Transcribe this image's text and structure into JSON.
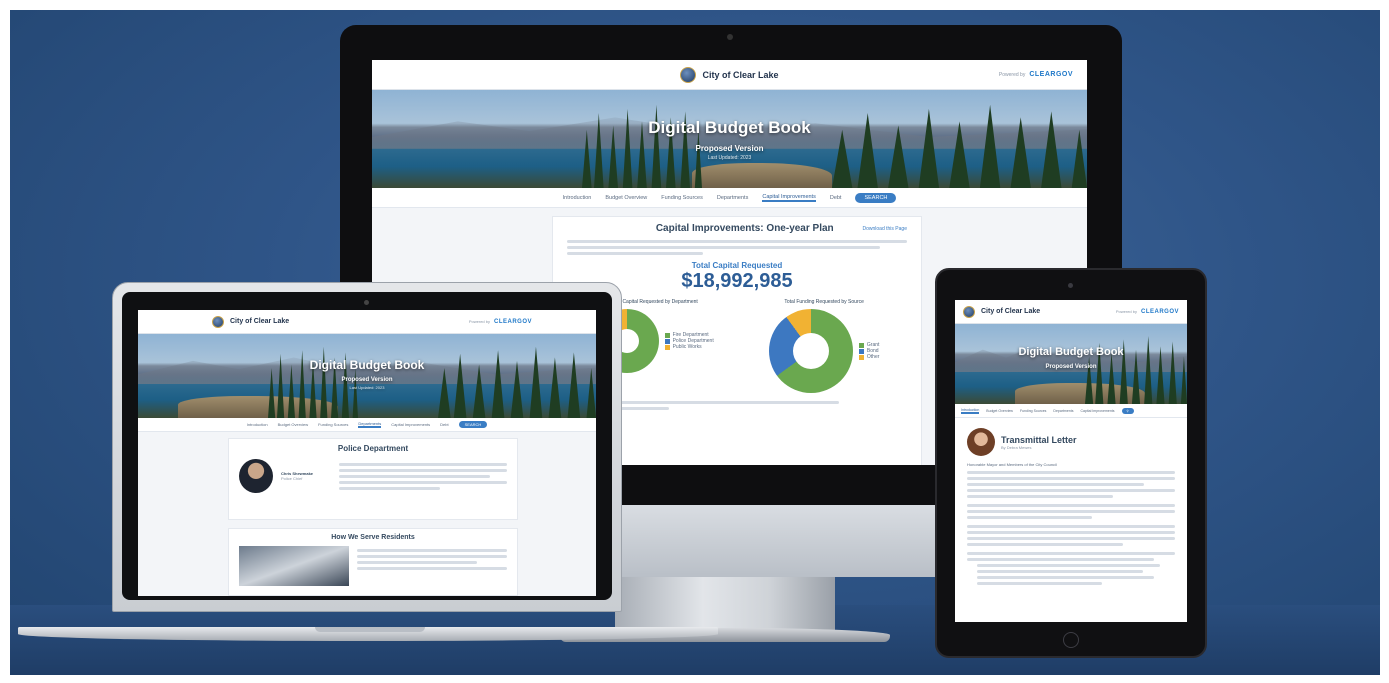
{
  "site": {
    "city_name": "City of Clear Lake",
    "powered_by": "Powered by",
    "vendor": "CLEARGOV",
    "hero_title": "Digital Budget Book",
    "hero_version": "Proposed Version",
    "hero_fy": "Last Updated: 2023",
    "search_label": "SEARCH"
  },
  "desktop": {
    "nav": [
      "Introduction",
      "Budget Overview",
      "Funding Sources",
      "Departments",
      "Capital Improvements",
      "Debt"
    ],
    "active_nav": "Capital Improvements",
    "page_title": "Capital Improvements: One-year Plan",
    "download_link": "Download this Page",
    "total_label": "Total Capital Requested",
    "total_value": "$18,992,985",
    "chart1_title": "Total Capital Requested by Department",
    "chart2_title": "Total Funding Requested by Source",
    "chart1_legend": [
      "Fire Department",
      "Police Department",
      "Public Works"
    ],
    "chart2_legend": [
      "Grant",
      "Bond",
      "Other"
    ]
  },
  "laptop": {
    "nav": [
      "Introduction",
      "Budget Overview",
      "Funding Sources",
      "Departments",
      "Capital Improvements",
      "Debt"
    ],
    "active_nav": "Departments",
    "dept_title": "Police Department",
    "person_name": "Chris Shewmake",
    "person_role": "Police Chief",
    "section_title": "How We Serve Residents"
  },
  "tablet": {
    "nav": [
      "Introduction",
      "Budget Overview",
      "Funding Sources",
      "Departments",
      "Capital Improvements"
    ],
    "active_nav": "Introduction",
    "letter_title": "Transmittal Letter",
    "letter_author": "By Debra Mewes",
    "greeting": "Honorable Mayor and Members of the City Council"
  },
  "chart_data": [
    {
      "type": "pie",
      "title": "Total Capital Requested by Department",
      "categories": [
        "Fire Department",
        "Police Department",
        "Public Works"
      ],
      "values": [
        75,
        15,
        10
      ],
      "colors": [
        "#6aa84f",
        "#3d78c1",
        "#f1b233"
      ]
    },
    {
      "type": "pie",
      "title": "Total Funding Requested by Source",
      "categories": [
        "Grant",
        "Bond",
        "Other"
      ],
      "values": [
        65,
        25,
        10
      ],
      "colors": [
        "#6aa84f",
        "#3d78c1",
        "#f1b233"
      ]
    }
  ]
}
